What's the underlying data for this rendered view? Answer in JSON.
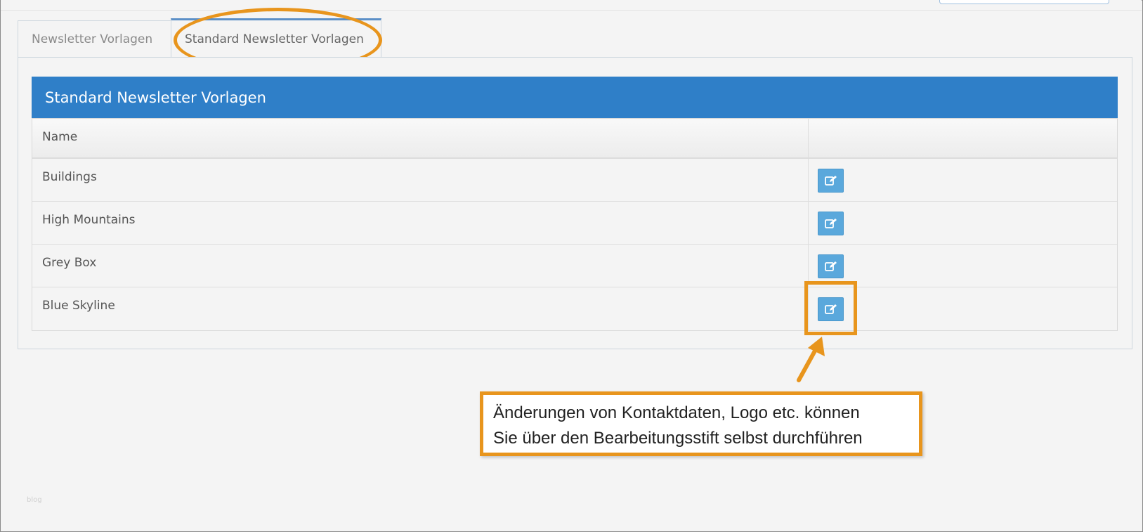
{
  "tabs": [
    {
      "label": "Newsletter Vorlagen"
    },
    {
      "label": "Standard Newsletter Vorlagen"
    }
  ],
  "panel": {
    "title": "Standard Newsletter Vorlagen"
  },
  "table": {
    "headers": [
      "Name",
      ""
    ],
    "rows": [
      {
        "name": "Buildings"
      },
      {
        "name": "High Mountains"
      },
      {
        "name": "Grey Box"
      },
      {
        "name": "Blue Skyline"
      }
    ]
  },
  "callout": {
    "line1": "Änderungen von Kontaktdaten, Logo etc. können",
    "line2": "Sie über den Bearbeitungsstift selbst durchführen"
  },
  "watermark": "blog",
  "colors": {
    "header_bg": "#2f7fc8",
    "edit_button": "#5aa8dc",
    "highlight": "#e8951d"
  },
  "icons": {
    "edit": "pencil-square-edit-icon"
  }
}
